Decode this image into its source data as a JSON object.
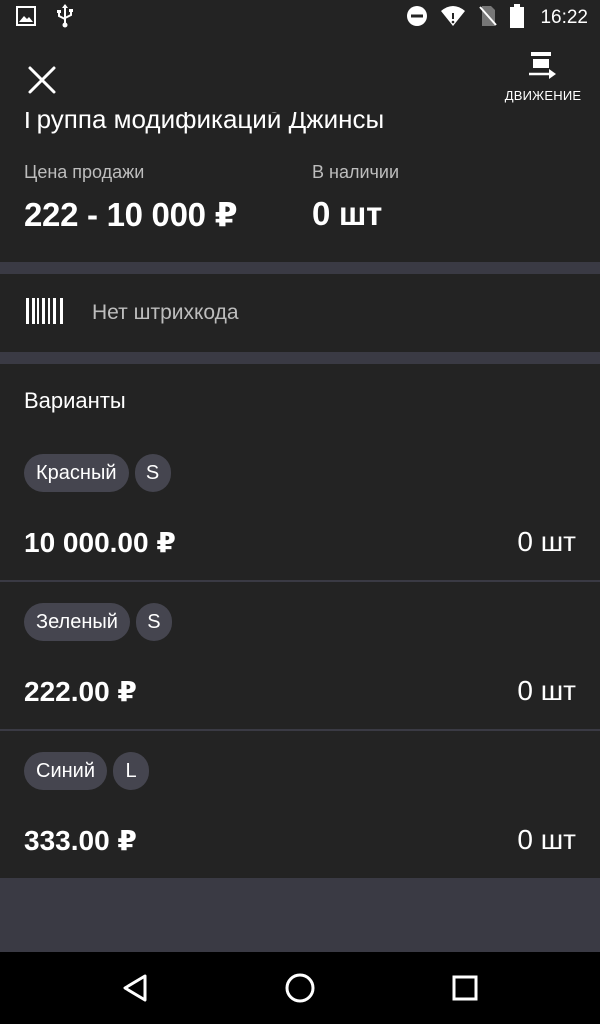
{
  "status_bar": {
    "time": "16:22",
    "left_icons": [
      "image-icon",
      "usb-icon"
    ],
    "right_icons": [
      "do-not-disturb-icon",
      "wifi-icon",
      "no-sim-icon",
      "battery-icon"
    ]
  },
  "header": {
    "title": "Группа модификаций Джинсы",
    "move_label": "ДВИЖЕНИЕ",
    "price_label": "Цена продажи",
    "price_value": "222 - 10 000 ₽",
    "stock_label": "В наличии",
    "stock_value": "0 шт"
  },
  "barcode": {
    "text": "Нет штрихкода"
  },
  "variants": {
    "title": "Варианты",
    "items": [
      {
        "color": "Красный",
        "size": "S",
        "price": "10 000.00 ₽",
        "stock": "0 шт"
      },
      {
        "color": "Зеленый",
        "size": "S",
        "price": "222.00 ₽",
        "stock": "0 шт"
      },
      {
        "color": "Синий",
        "size": "L",
        "price": "333.00 ₽",
        "stock": "0 шт"
      }
    ]
  },
  "navigation": [
    "back-icon",
    "home-icon",
    "recents-icon"
  ],
  "colors": {
    "panel": "#232323",
    "background": "#3a3a44",
    "chip": "#45454f",
    "secondary_text": "#bdbdbd",
    "nav_bar": "#000000"
  }
}
